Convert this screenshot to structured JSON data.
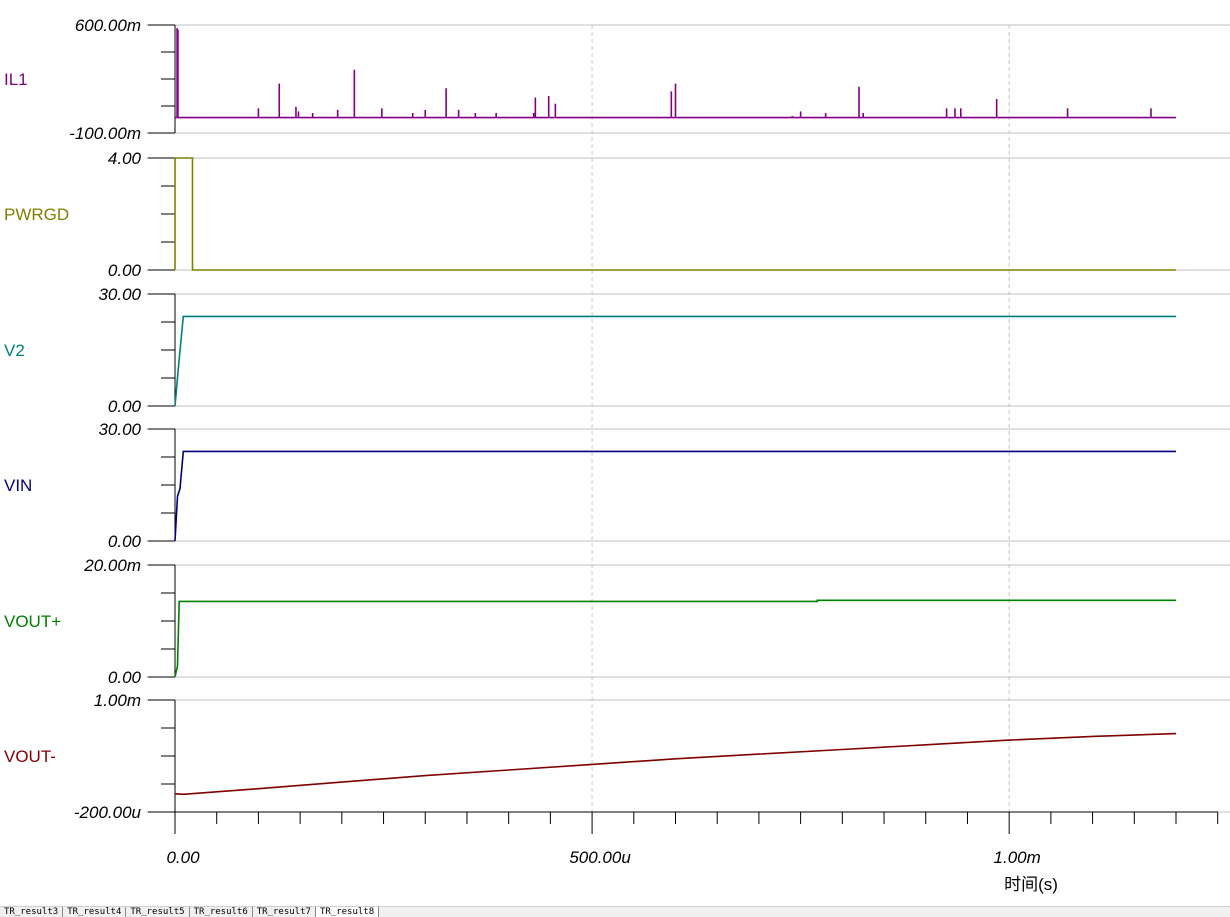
{
  "chart_data": {
    "type": "line",
    "x_axis": {
      "title": "时间(s)",
      "ticks": [
        {
          "value": 0,
          "label": "0.00"
        },
        {
          "value": 0.0005,
          "label": "500.00u"
        },
        {
          "value": 0.001,
          "label": "1.00m"
        }
      ],
      "xlim": [
        0,
        0.0012
      ],
      "grid": true
    },
    "panels": [
      {
        "name": "IL1",
        "color": "#800080",
        "ylim": [
          -0.1,
          0.6
        ],
        "ytick_labels": [
          "600.00m",
          "-100.00m"
        ],
        "series": {
          "baseline": 0,
          "spikes": [
            [
              2.5e-06,
              0.58
            ],
            [
              3.5e-06,
              0.57
            ],
            [
              0.0001,
              0.06
            ],
            [
              0.000125,
              0.22
            ],
            [
              0.000145,
              0.07
            ],
            [
              0.000148,
              0.04
            ],
            [
              0.000165,
              0.03
            ],
            [
              0.000195,
              0.05
            ],
            [
              0.000215,
              0.31
            ],
            [
              0.000248,
              0.06
            ],
            [
              0.000285,
              0.03
            ],
            [
              0.0003,
              0.05
            ],
            [
              0.000325,
              0.19
            ],
            [
              0.00034,
              0.05
            ],
            [
              0.00036,
              0.03
            ],
            [
              0.000385,
              0.03
            ],
            [
              0.00043,
              0.03
            ],
            [
              0.000432,
              0.13
            ],
            [
              0.000448,
              0.14
            ],
            [
              0.000456,
              0.09
            ],
            [
              0.000595,
              0.17
            ],
            [
              0.0006,
              0.22
            ],
            [
              0.00074,
              0.01
            ],
            [
              0.00075,
              0.04
            ],
            [
              0.00078,
              0.03
            ],
            [
              0.00082,
              0.2
            ],
            [
              0.000825,
              0.03
            ],
            [
              0.000925,
              0.06
            ],
            [
              0.000935,
              0.06
            ],
            [
              0.000942,
              0.06
            ],
            [
              0.000985,
              0.12
            ],
            [
              0.00107,
              0.06
            ],
            [
              0.00117,
              0.06
            ]
          ]
        }
      },
      {
        "name": "PWRGD",
        "color": "#808000",
        "ylim": [
          0,
          4
        ],
        "ytick_labels": [
          "4.00",
          "0.00"
        ],
        "series": {
          "x": [
            0,
            0,
            2.1e-05,
            2.1e-05,
            0.0012
          ],
          "y": [
            0,
            4,
            4,
            0,
            0
          ]
        }
      },
      {
        "name": "V2",
        "color": "#008080",
        "ylim": [
          0,
          30
        ],
        "ytick_labels": [
          "30.00",
          "0.00"
        ],
        "series": {
          "x": [
            0,
            4e-06,
            1e-05,
            0.0012
          ],
          "y": [
            0,
            10,
            24,
            24
          ]
        }
      },
      {
        "name": "VIN",
        "color": "#000080",
        "ylim": [
          0,
          30
        ],
        "ytick_labels": [
          "30.00",
          "0.00"
        ],
        "series": {
          "x": [
            0,
            3e-06,
            6e-06,
            1e-05,
            0.0012
          ],
          "y": [
            0,
            12,
            14,
            24,
            24
          ]
        }
      },
      {
        "name": "VOUT+",
        "color": "#008000",
        "ylim": [
          0,
          0.02
        ],
        "ytick_labels": [
          "20.00m",
          "0.00"
        ],
        "series": {
          "x": [
            0,
            3e-06,
            5e-06,
            0.00077,
            0.00077,
            0.0012
          ],
          "y": [
            0,
            0.002,
            0.0135,
            0.0135,
            0.0137,
            0.0137
          ]
        }
      },
      {
        "name": "VOUT-",
        "color": "#800000",
        "ylim": [
          -0.0002,
          0.001
        ],
        "ytick_labels": [
          "1.00m",
          "-200.00u"
        ],
        "series": {
          "x": [
            0,
            1e-05,
            0.0001,
            0.0002,
            0.0003,
            0.0004,
            0.0005,
            0.0006,
            0.0007,
            0.0008,
            0.0009,
            0.001,
            0.0011,
            0.0012
          ],
          "y": [
            -5e-06,
            -1e-05,
            5e-05,
            0.00012,
            0.00019,
            0.00025,
            0.00031,
            0.00037,
            0.00042,
            0.00047,
            0.00052,
            0.00057,
            0.00061,
            0.00064
          ]
        }
      }
    ]
  },
  "tabs": [
    "TR_result3",
    "TR_result4",
    "TR_result5",
    "TR_result6",
    "TR_result7",
    "TR_result8"
  ],
  "active_tab": 5
}
